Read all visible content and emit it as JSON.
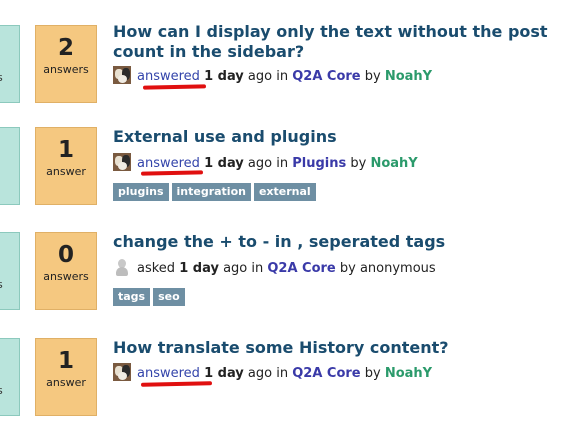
{
  "questions": [
    {
      "votes_label": "s",
      "answers_count": "2",
      "answers_label": "answers",
      "title": "How can I display only the text without the post count in the sidebar?",
      "meta": {
        "what": "answered",
        "when_num": "1 day",
        "when_rest": " ago in ",
        "category": "Q2A Core",
        "by": " by ",
        "who": "NoahY"
      },
      "avatar": "user-avatar-icon",
      "tags": []
    },
    {
      "votes_label": ".",
      "answers_count": "1",
      "answers_label": "answer",
      "title": "External use and plugins",
      "meta": {
        "what": "answered",
        "when_num": "1 day",
        "when_rest": " ago in ",
        "category": "Plugins",
        "by": " by ",
        "who": "NoahY"
      },
      "avatar": "user-avatar-icon",
      "tags": [
        "plugins",
        "integration",
        "external"
      ]
    },
    {
      "votes_label": "s",
      "answers_count": "0",
      "answers_label": "answers",
      "title": "change the + to - in , seperated tags",
      "meta": {
        "what": "asked",
        "when_num": "1 day",
        "when_rest": " ago in ",
        "category": "Q2A Core",
        "by": " by ",
        "who": "anonymous"
      },
      "avatar": "anonymous-avatar-icon",
      "tags": [
        "tags",
        "seo"
      ]
    },
    {
      "votes_label": "s",
      "answers_count": "1",
      "answers_label": "answer",
      "title": "How translate some History content?",
      "meta": {
        "what": "answered",
        "when_num": "1 day",
        "when_rest": " ago in ",
        "category": "Q2A Core",
        "by": " by ",
        "who": "NoahY"
      },
      "avatar": "user-avatar-icon",
      "tags": []
    }
  ],
  "colors": {
    "answer_box": "#f5c880",
    "vote_box": "#b9e4dc",
    "title": "#1a4c6e",
    "user": "#2b9a6b",
    "category": "#3a3aa8",
    "tag_bg": "#6e8fa3",
    "annotation_underline": "#e01010"
  }
}
